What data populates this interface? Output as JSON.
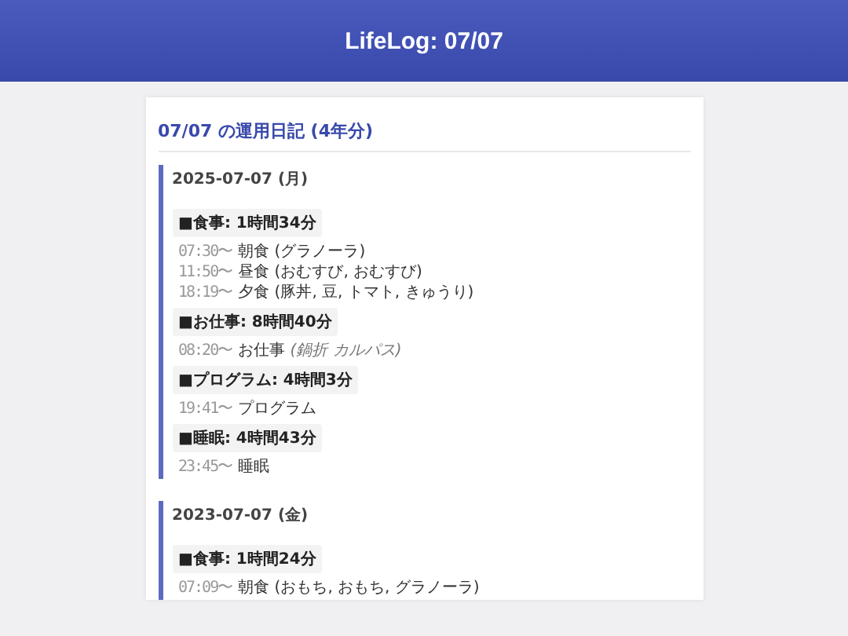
{
  "header": {
    "title": "LifeLog: 07/07"
  },
  "heading": "07/07 の運用日記 (4年分)",
  "days": [
    {
      "date": "2025-07-07 (月)",
      "categories": [
        {
          "label": "■食事: 1時間34分",
          "entries": [
            {
              "time": "07:30〜",
              "text": "朝食 (グラノーラ)"
            },
            {
              "time": "11:50〜",
              "text": "昼食 (おむすび, おむすび)"
            },
            {
              "time": "18:19〜",
              "text": "夕食 (豚丼, 豆, トマト, きゅうり)"
            }
          ]
        },
        {
          "label": "■お仕事: 8時間40分",
          "entries": [
            {
              "time": "08:20〜",
              "text": "お仕事",
              "note": "(鍋折 カルパス)"
            }
          ]
        },
        {
          "label": "■プログラム: 4時間3分",
          "entries": [
            {
              "time": "19:41〜",
              "text": "プログラム"
            }
          ]
        },
        {
          "label": "■睡眠: 4時間43分",
          "entries": [
            {
              "time": "23:45〜",
              "text": "睡眠"
            }
          ]
        }
      ]
    },
    {
      "date": "2023-07-07 (金)",
      "categories": [
        {
          "label": "■食事: 1時間24分",
          "entries": [
            {
              "time": "07:09〜",
              "text": "朝食 (おもち, おもち, グラノーラ)"
            }
          ]
        }
      ]
    }
  ]
}
